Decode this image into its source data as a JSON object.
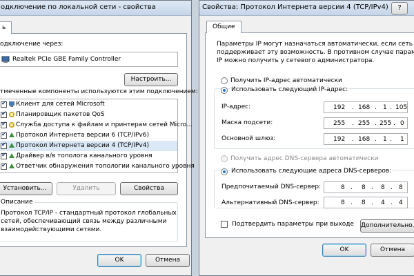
{
  "left_window": {
    "title": "одключение по локальной сети - свойства",
    "tab_label": "ь",
    "connect_via_label": "одключение через:",
    "adapter_name": "Realtek PCIe GBE Family Controller",
    "configure_button": "Настроить...",
    "components_label": "тмеченные компоненты используются этим подключением:",
    "components": [
      {
        "label": "Клиент для сетей Microsoft",
        "checked": true
      },
      {
        "label": "Планировщик пакетов QoS",
        "checked": true
      },
      {
        "label": "Служба доступа к файлам и принтерам сетей Micro...",
        "checked": true
      },
      {
        "label": "Протокол Интернета версии 6 (TCP/IPv6)",
        "checked": true
      },
      {
        "label": "Протокол Интернета версии 4 (TCP/IPv4)",
        "checked": true
      },
      {
        "label": "Драйвер в/в тополога канального уровня",
        "checked": true
      },
      {
        "label": "Ответчик обнаружения топологии канального уровня",
        "checked": true
      }
    ],
    "install_button": "Установить...",
    "remove_button": "Удалить",
    "properties_button": "Свойства",
    "description_legend": "Описание",
    "description_text_1": "Протокол TCP/IP - стандартный протокол глобальных",
    "description_text_2": "сетей, обеспечивающий связь между различными",
    "description_text_3": "взаимодействующими сетями.",
    "ok_button": "OK",
    "cancel_button": "Отмена"
  },
  "right_window": {
    "title": "Свойства: Протокол Интернета версии 4 (TCP/IPv4)",
    "help_glyph": "?",
    "tab_label": "Общие",
    "info_text_1": "Параметры IP могут назначаться автоматически, если сеть",
    "info_text_2": "поддерживает эту возможность. В противном случае параметры",
    "info_text_3": "IP можно получить у сетевого администратора.",
    "radio_auto_ip": "Получить IP-адрес автоматически",
    "radio_manual_ip": "Использовать следующий IP-адрес:",
    "ip_label": "IP-адрес:",
    "ip_value": [
      "192",
      "168",
      "1",
      "105"
    ],
    "mask_label": "Маска подсети:",
    "mask_value": [
      "255",
      "255",
      "255",
      "0"
    ],
    "gateway_label": "Основной шлюз:",
    "gateway_value": [
      "192",
      "168",
      "1",
      "1"
    ],
    "radio_auto_dns": "Получить адрес DNS-сервера автоматически",
    "radio_manual_dns": "Использовать следующие адреса DNS-серверов:",
    "pref_dns_label": "Предпочитаемый DNS-сервер:",
    "pref_dns_value": [
      "8",
      "8",
      "8",
      "8"
    ],
    "alt_dns_label": "Альтернативный DNS-сервер:",
    "alt_dns_value": [
      "8",
      "8",
      "4",
      "4"
    ],
    "validate_checkbox": "Подтвердить параметры при выходе",
    "advanced_button": "Дополнительно...",
    "ok_button": "OK",
    "cancel_button": "Отмена"
  }
}
